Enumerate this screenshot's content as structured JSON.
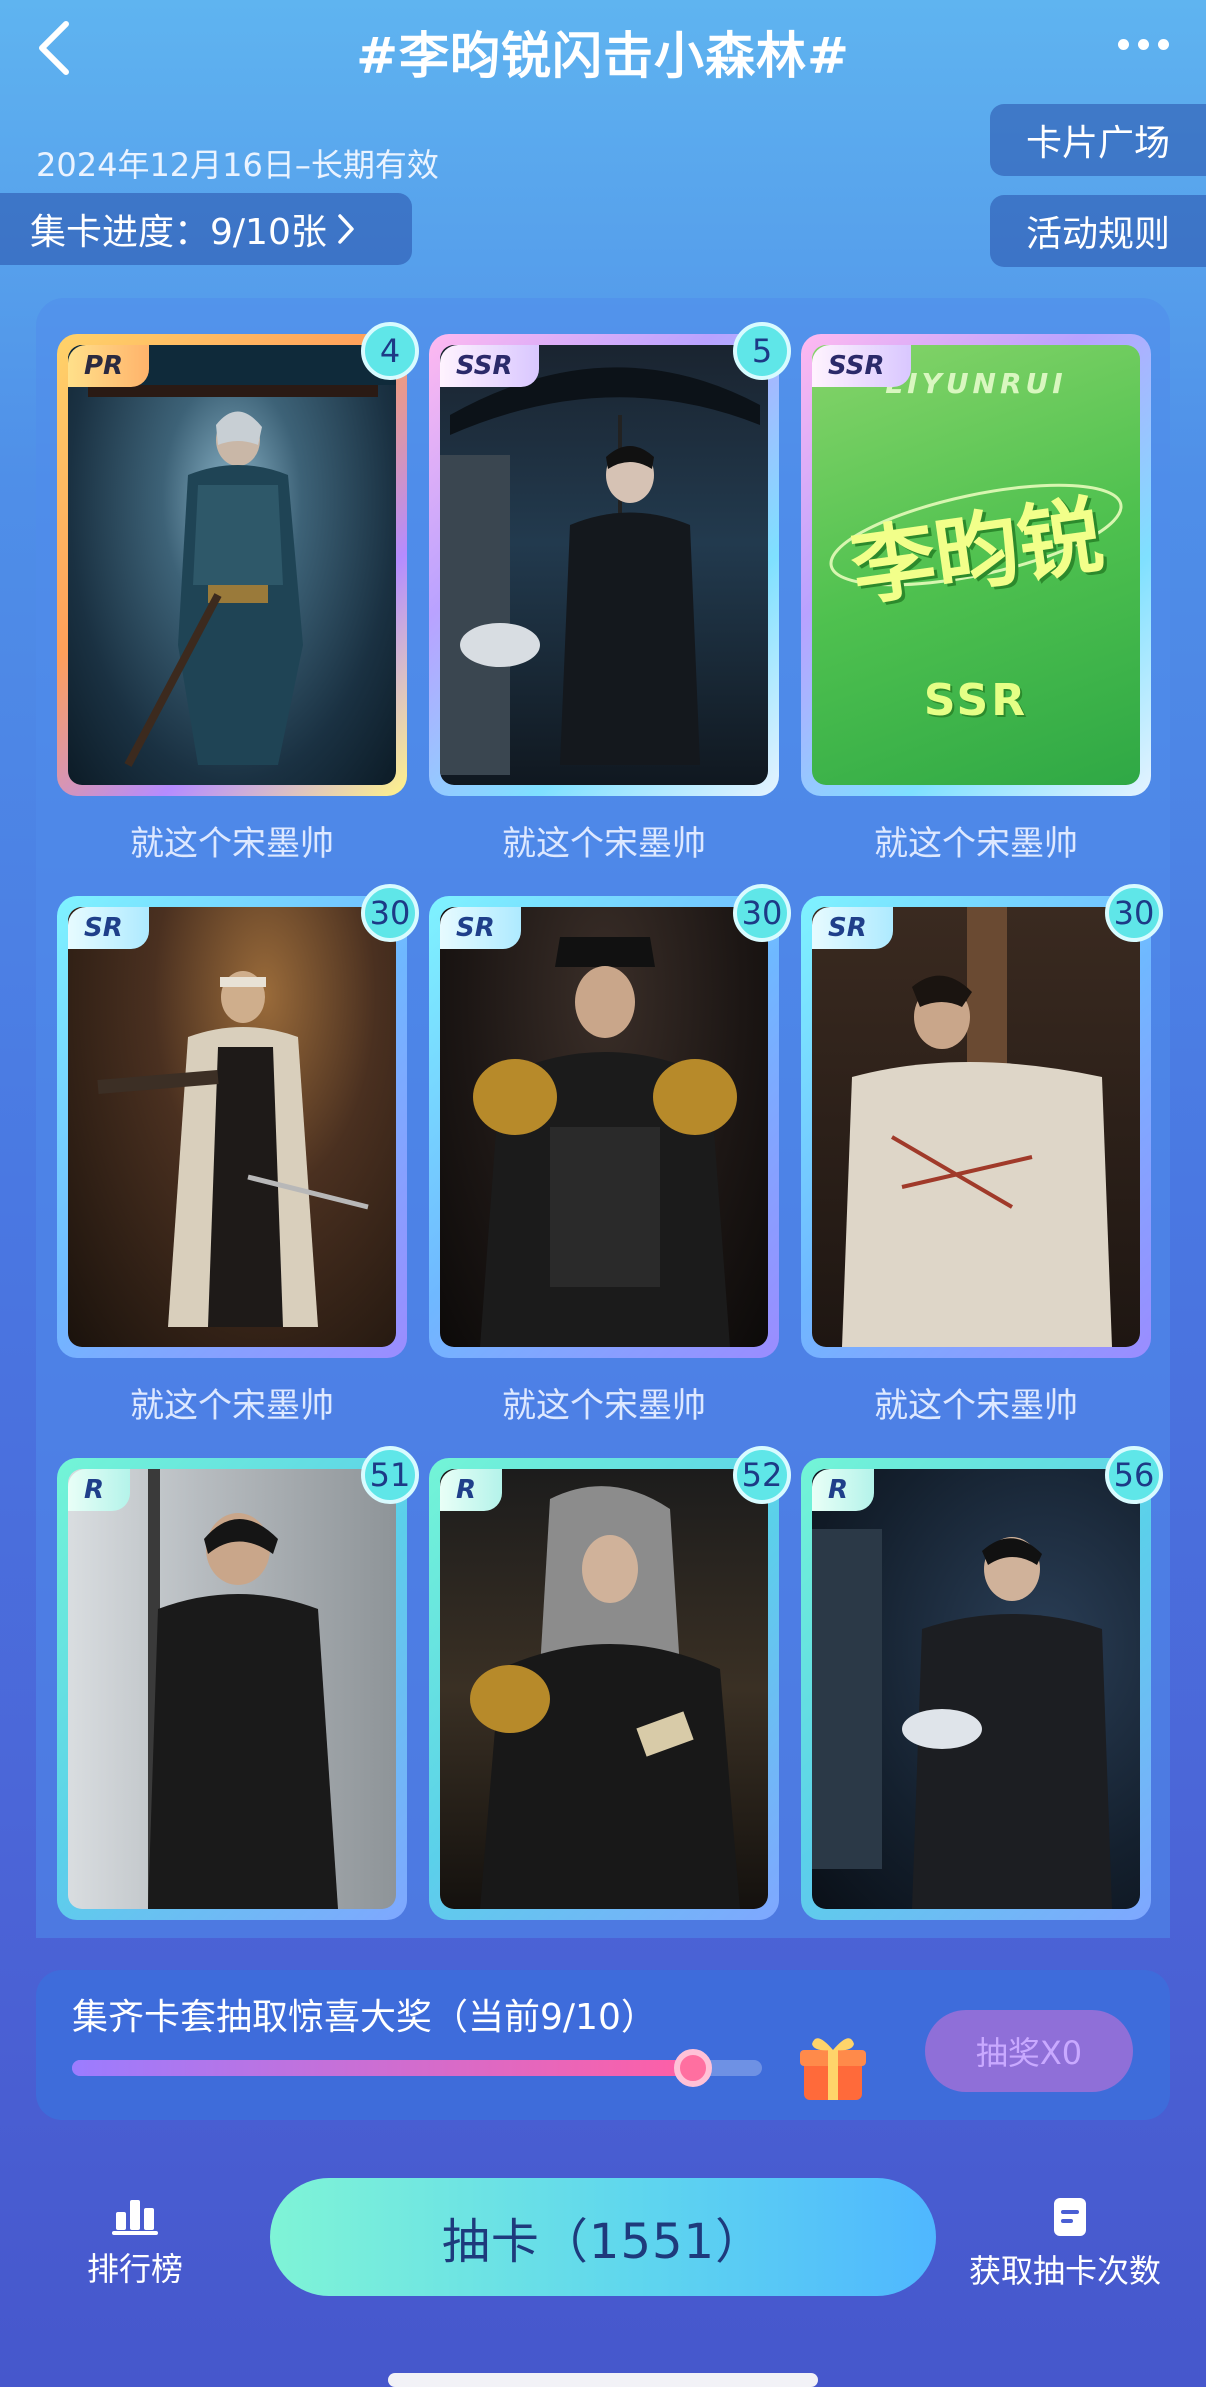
{
  "header": {
    "title": "#李昀锐闪击小森林#",
    "back_icon": "chevron-left-icon",
    "more_icon": "more-dots-icon"
  },
  "info": {
    "date": "2024年12月16日–长期有效",
    "progress_label": "集卡进度：9/10张",
    "card_square_label": "卡片广场",
    "rules_label": "活动规则"
  },
  "cards": [
    {
      "rarity": "PR",
      "count": "4",
      "caption": "就这个宋墨帅"
    },
    {
      "rarity": "SSR",
      "count": "5",
      "caption": "就这个宋墨帅"
    },
    {
      "rarity": "SSR",
      "count": "",
      "caption": "就这个宋墨帅",
      "art_top": "LIYUNRUI",
      "art_main": "李昀锐",
      "art_bottom": "SSR"
    },
    {
      "rarity": "SR",
      "count": "30",
      "caption": "就这个宋墨帅"
    },
    {
      "rarity": "SR",
      "count": "30",
      "caption": "就这个宋墨帅"
    },
    {
      "rarity": "SR",
      "count": "30",
      "caption": "就这个宋墨帅"
    },
    {
      "rarity": "R",
      "count": "51",
      "caption": ""
    },
    {
      "rarity": "R",
      "count": "52",
      "caption": ""
    },
    {
      "rarity": "R",
      "count": "56",
      "caption": ""
    }
  ],
  "prize": {
    "text": "集齐卡套抽取惊喜大奖（当前9/10）",
    "progress_fraction": 0.9,
    "lottery_label": "抽奖X0"
  },
  "bottom": {
    "ranking_label": "排行榜",
    "draw_label": "抽卡（1551）",
    "get_chances_label": "获取抽卡次数"
  },
  "colors": {
    "accent_cyan": "#5fe6e8",
    "draw_button_start": "#7ff4d6",
    "lottery_button": "#8f6fd8"
  }
}
